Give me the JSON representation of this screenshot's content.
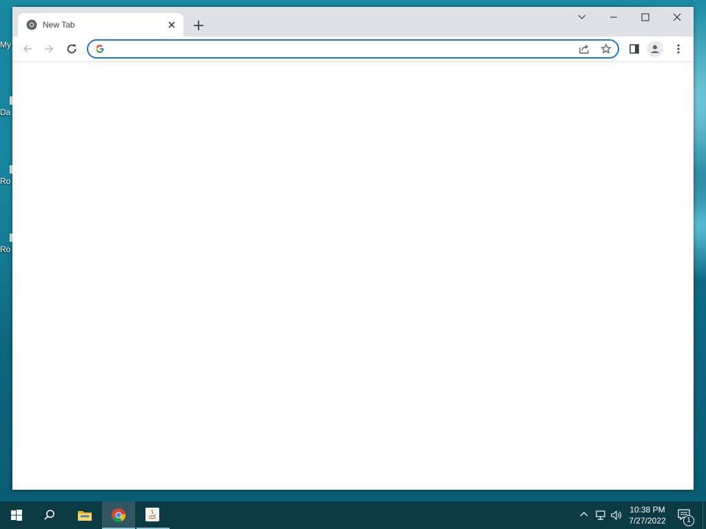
{
  "desktop": {
    "icons": [
      {
        "label": "My"
      },
      {
        "label": "Da"
      },
      {
        "label": "Ro"
      },
      {
        "label": "Ro"
      }
    ]
  },
  "browser": {
    "tab": {
      "title": "New Tab",
      "favicon": "chrome-icon"
    },
    "omnibox": {
      "value": "",
      "placeholder": ""
    },
    "accent": "#1a73e8",
    "tabstrip_color": "#dee1e6"
  },
  "taskbar": {
    "apps": [
      "start-icon",
      "search-icon",
      "file-explorer-icon",
      "chrome-icon",
      "java-icon"
    ],
    "clock": {
      "time": "10:38 PM",
      "date": "7/27/2022"
    },
    "notification_count": "1"
  }
}
